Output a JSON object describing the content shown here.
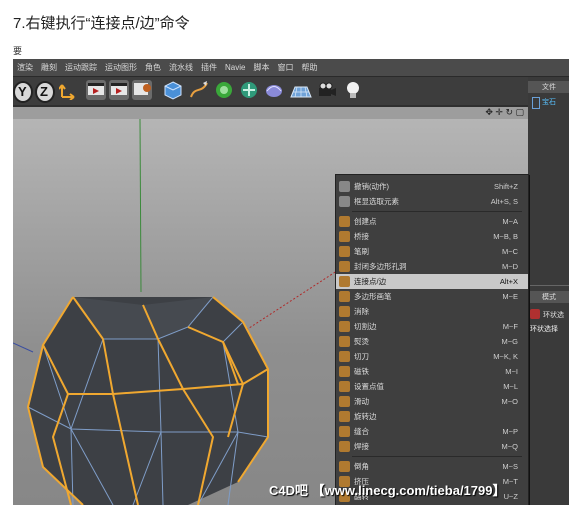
{
  "page": {
    "title": "7.右键执行“连接点/边”命令",
    "mark": "要"
  },
  "menubar": {
    "items": [
      "渲染",
      "雕刻",
      "运动跟踪",
      "运动图形",
      "角色",
      "流水线",
      "插件",
      "Navie",
      "脚本",
      "窗口",
      "帮助"
    ]
  },
  "toolbar": {
    "y_label": "Y",
    "z_label": "Z"
  },
  "right_panel": {
    "tab1": "文件",
    "object_name": "宝石",
    "tab2": "模式",
    "item1": "环状选",
    "item2": "环状选择"
  },
  "context_menu": {
    "items": [
      {
        "label": "撤销(动作)",
        "shortcut": "Shift+Z"
      },
      {
        "label": "框显选取元素",
        "shortcut": "Alt+S, S"
      },
      {
        "label": "创建点",
        "shortcut": "M~A"
      },
      {
        "label": "桥接",
        "shortcut": "M~B, B"
      },
      {
        "label": "笔刷",
        "shortcut": "M~C"
      },
      {
        "label": "封闭多边形孔洞",
        "shortcut": "M~D"
      },
      {
        "label": "连接点/边",
        "shortcut": "Alt+X",
        "highlighted": true
      },
      {
        "label": "多边形画笔",
        "shortcut": "M~E"
      },
      {
        "label": "消除",
        "shortcut": ""
      },
      {
        "label": "切割边",
        "shortcut": "M~F"
      },
      {
        "label": "熨烫",
        "shortcut": "M~G"
      },
      {
        "label": "切刀",
        "shortcut": "M~K, K"
      },
      {
        "label": "磁铁",
        "shortcut": "M~I"
      },
      {
        "label": "设置点值",
        "shortcut": "M~L"
      },
      {
        "label": "滑动",
        "shortcut": "M~O"
      },
      {
        "label": "旋转边",
        "shortcut": ""
      },
      {
        "label": "缝合",
        "shortcut": "M~P"
      },
      {
        "label": "焊接",
        "shortcut": "M~Q"
      },
      {
        "label": "倒角",
        "shortcut": "M~S"
      },
      {
        "label": "挤压",
        "shortcut": "M~T"
      },
      {
        "label": "翻转",
        "shortcut": "U~Z"
      }
    ]
  },
  "watermark": "C4D吧 【www.linecg.com/tieba/1799】",
  "colors": {
    "accent_orange": "#f0a830",
    "edge_blue": "#7f9dc8",
    "face": "#3d4045"
  }
}
